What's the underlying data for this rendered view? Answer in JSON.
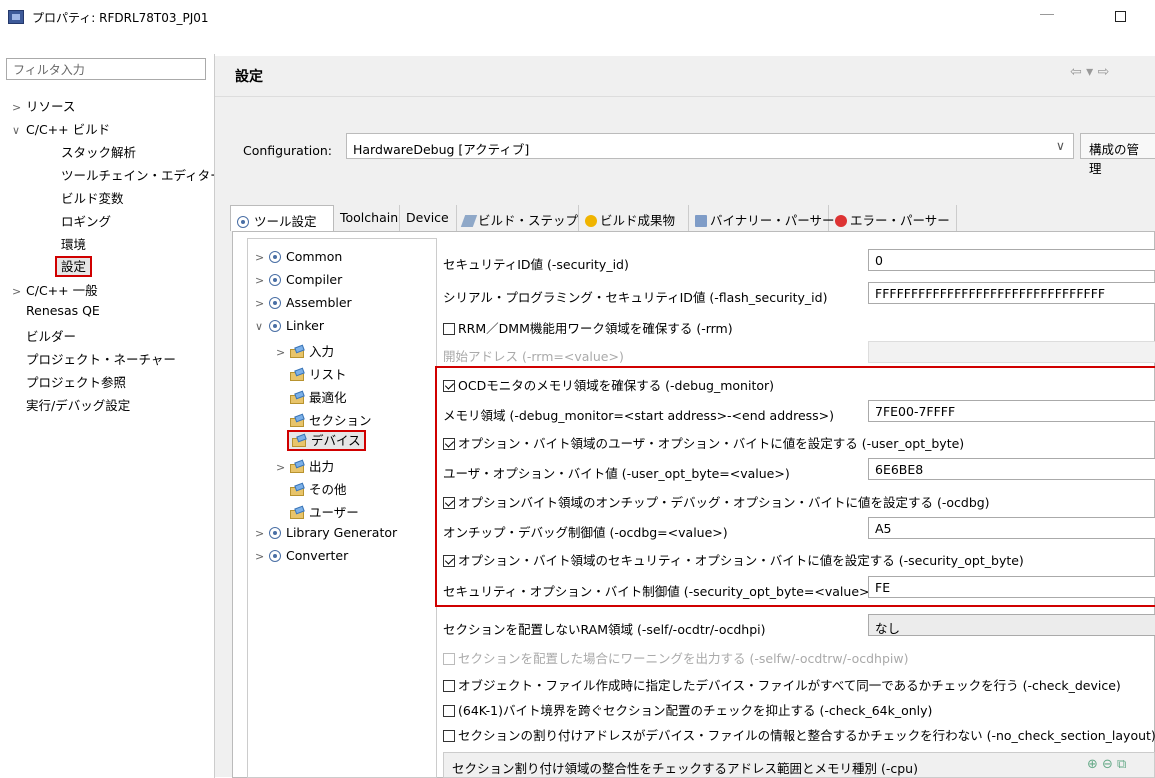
{
  "window": {
    "title": "プロパティ: RFDRL78T03_PJ01"
  },
  "filter": {
    "placeholder": "フィルタ入力"
  },
  "left_tree": [
    {
      "label": "リソース",
      "arrow": ">"
    },
    {
      "label": "C/C++ ビルド",
      "arrow": "∨"
    },
    {
      "label": "スタック解析"
    },
    {
      "label": "ツールチェイン・エディター"
    },
    {
      "label": "ビルド変数"
    },
    {
      "label": "ロギング"
    },
    {
      "label": "環境"
    },
    {
      "label": "設定"
    },
    {
      "label": "C/C++ 一般",
      "arrow": ">"
    },
    {
      "label": "Renesas QE"
    },
    {
      "label": "ビルダー"
    },
    {
      "label": "プロジェクト・ネーチャー"
    },
    {
      "label": "プロジェクト参照"
    },
    {
      "label": "実行/デバッグ設定"
    }
  ],
  "header": {
    "title": "設定",
    "nav": "⇦ ▾ ⇨"
  },
  "configuration": {
    "label": "Configuration:",
    "value": "HardwareDebug [アクティブ]",
    "manage": "構成の管理"
  },
  "tabs": [
    "ツール設定",
    "Toolchain",
    "Device",
    "ビルド・ステップ",
    "ビルド成果物",
    "バイナリー・パーサー",
    "エラー・パーサー"
  ],
  "tool_tree": [
    {
      "label": "Common",
      "arrow": ">"
    },
    {
      "label": "Compiler",
      "arrow": ">"
    },
    {
      "label": "Assembler",
      "arrow": ">"
    },
    {
      "label": "Linker",
      "arrow": "∨"
    },
    {
      "label": "入力",
      "arrow": ">"
    },
    {
      "label": "リスト"
    },
    {
      "label": "最適化"
    },
    {
      "label": "セクション"
    },
    {
      "label": "デバイス"
    },
    {
      "label": "出力",
      "arrow": ">"
    },
    {
      "label": "その他"
    },
    {
      "label": "ユーザー"
    },
    {
      "label": "Library Generator",
      "arrow": ">"
    },
    {
      "label": "Converter",
      "arrow": ">"
    }
  ],
  "settings": {
    "security_id": {
      "label": "セキュリティID値 (-security_id)",
      "value": "0"
    },
    "flash_security_id": {
      "label": "シリアル・プログラミング・セキュリティID値 (-flash_security_id)",
      "value": "FFFFFFFFFFFFFFFFFFFFFFFFFFFFFFFF"
    },
    "rrm": {
      "label": "RRM／DMM機能用ワーク領域を確保する (-rrm)"
    },
    "rrm_start": {
      "label": "開始アドレス (-rrm=<value>)"
    },
    "debug_monitor": {
      "label": "OCDモニタのメモリ領域を確保する (-debug_monitor)"
    },
    "debug_monitor_area": {
      "label": "メモリ領域 (-debug_monitor=<start address>-<end address>)",
      "value": "7FE00-7FFFF"
    },
    "user_opt_byte": {
      "label": "オプション・バイト領域のユーザ・オプション・バイトに値を設定する (-user_opt_byte)"
    },
    "user_opt_byte_value": {
      "label": "ユーザ・オプション・バイト値 (-user_opt_byte=<value>)",
      "value": "6E6BE8"
    },
    "ocdbg": {
      "label": "オプションバイト領域のオンチップ・デバッグ・オプション・バイトに値を設定する (-ocdbg)"
    },
    "ocdbg_value": {
      "label": "オンチップ・デバッグ制御値 (-ocdbg=<value>)",
      "value": "A5"
    },
    "security_opt_byte": {
      "label": "オプション・バイト領域のセキュリティ・オプション・バイトに値を設定する (-security_opt_byte)"
    },
    "security_opt_byte_value": {
      "label": "セキュリティ・オプション・バイト制御値 (-security_opt_byte=<value>)",
      "value": "FE"
    },
    "self_ram": {
      "label": "セクションを配置しないRAM領域 (-self/-ocdtr/-ocdhpi)",
      "value": "なし"
    },
    "selfw": {
      "label": "セクションを配置した場合にワーニングを出力する (-selfw/-ocdtrw/-ocdhpiw)"
    },
    "check_device": {
      "label": "オブジェクト・ファイル作成時に指定したデバイス・ファイルがすべて同一であるかチェックを行う (-check_device)"
    },
    "check_64k": {
      "label": "(64K-1)バイト境界を跨ぐセクション配置のチェックを抑止する (-check_64k_only)"
    },
    "no_check_section": {
      "label": "セクションの割り付けアドレスがデバイス・ファイルの情報と整合するかチェックを行わない (-no_check_section_layout)"
    },
    "cpu": {
      "label": "セクション割り付け領域の整合性をチェックするアドレス範囲とメモリ種別 (-cpu)"
    }
  }
}
